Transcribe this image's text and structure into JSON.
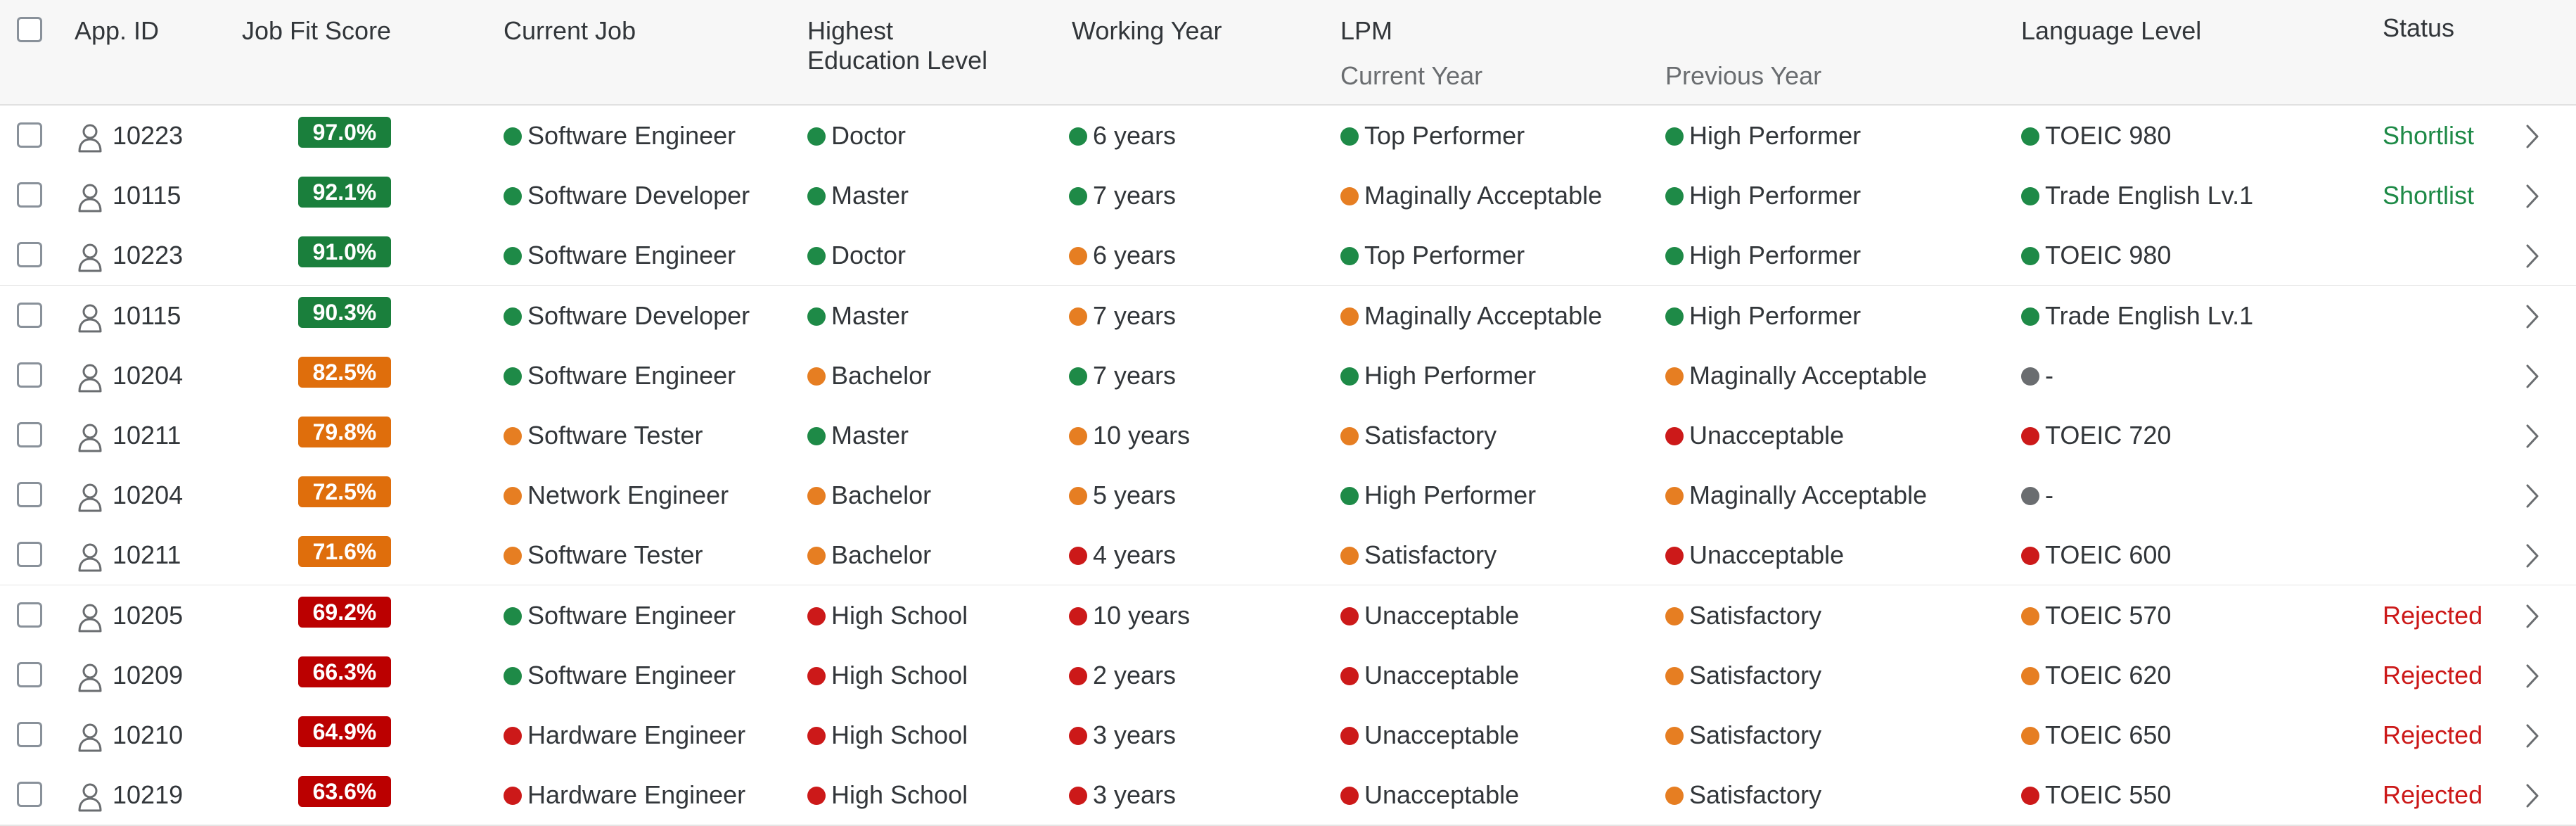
{
  "colors": {
    "green": "#1e8a47",
    "orange": "#e67e22",
    "red": "#cc1919",
    "grey": "#6a6d70",
    "badge_green": "#1a7f3c",
    "badge_orange": "#df6e0c",
    "badge_red": "#bb0000"
  },
  "header": {
    "app_id": "App. ID",
    "job_fit_score": "Job Fit Score",
    "current_job": "Current Job",
    "education_line1": "Highest",
    "education_line2": "Education Level",
    "working_year": "Working Year",
    "lpm": "LPM",
    "lpm_current": "Current Year",
    "lpm_previous": "Previous Year",
    "language_level": "Language Level",
    "status": "Status"
  },
  "rows": [
    {
      "id": "10223",
      "score": "97.0%",
      "score_color": "green",
      "job": "Software Engineer",
      "job_color": "green",
      "edu": "Doctor",
      "edu_color": "green",
      "year": "6 years",
      "year_color": "green",
      "lpm_cur": "Top Performer",
      "lpm_cur_color": "green",
      "lpm_prev": "High Performer",
      "lpm_prev_color": "green",
      "lang": "TOEIC 980",
      "lang_color": "green",
      "status": "Shortlist",
      "status_color": "green"
    },
    {
      "id": "10115",
      "score": "92.1%",
      "score_color": "green",
      "job": "Software Developer",
      "job_color": "green",
      "edu": "Master",
      "edu_color": "green",
      "year": "7 years",
      "year_color": "green",
      "lpm_cur": "Maginally Acceptable",
      "lpm_cur_color": "orange",
      "lpm_prev": "High Performer",
      "lpm_prev_color": "green",
      "lang": "Trade English Lv.1",
      "lang_color": "green",
      "status": "Shortlist",
      "status_color": "green"
    },
    {
      "id": "10223",
      "score": "91.0%",
      "score_color": "green",
      "job": "Software Engineer",
      "job_color": "green",
      "edu": "Doctor",
      "edu_color": "green",
      "year": "6 years",
      "year_color": "orange",
      "lpm_cur": "Top Performer",
      "lpm_cur_color": "green",
      "lpm_prev": "High Performer",
      "lpm_prev_color": "green",
      "lang": "TOEIC 980",
      "lang_color": "green",
      "status": "",
      "status_color": "green"
    },
    {
      "id": "10115",
      "score": "90.3%",
      "score_color": "green",
      "job": "Software Developer",
      "job_color": "green",
      "edu": "Master",
      "edu_color": "green",
      "year": "7 years",
      "year_color": "orange",
      "lpm_cur": "Maginally Acceptable",
      "lpm_cur_color": "orange",
      "lpm_prev": "High Performer",
      "lpm_prev_color": "green",
      "lang": "Trade English Lv.1",
      "lang_color": "green",
      "status": "",
      "status_color": "green"
    },
    {
      "id": "10204",
      "score": "82.5%",
      "score_color": "orange",
      "job": "Software Engineer",
      "job_color": "green",
      "edu": "Bachelor",
      "edu_color": "orange",
      "year": "7 years",
      "year_color": "green",
      "lpm_cur": "High Performer",
      "lpm_cur_color": "green",
      "lpm_prev": "Maginally Acceptable",
      "lpm_prev_color": "orange",
      "lang": "-",
      "lang_color": "grey",
      "status": "",
      "status_color": "green"
    },
    {
      "id": "10211",
      "score": "79.8%",
      "score_color": "orange",
      "job": "Software Tester",
      "job_color": "orange",
      "edu": "Master",
      "edu_color": "green",
      "year": "10 years",
      "year_color": "orange",
      "lpm_cur": "Satisfactory",
      "lpm_cur_color": "orange",
      "lpm_prev": "Unacceptable",
      "lpm_prev_color": "red",
      "lang": "TOEIC 720",
      "lang_color": "red",
      "status": "",
      "status_color": "green"
    },
    {
      "id": "10204",
      "score": "72.5%",
      "score_color": "orange",
      "job": "Network Engineer",
      "job_color": "orange",
      "edu": "Bachelor",
      "edu_color": "orange",
      "year": "5 years",
      "year_color": "orange",
      "lpm_cur": "High Performer",
      "lpm_cur_color": "green",
      "lpm_prev": "Maginally Acceptable",
      "lpm_prev_color": "orange",
      "lang": "-",
      "lang_color": "grey",
      "status": "",
      "status_color": "green"
    },
    {
      "id": "10211",
      "score": "71.6%",
      "score_color": "orange",
      "job": "Software Tester",
      "job_color": "orange",
      "edu": "Bachelor",
      "edu_color": "orange",
      "year": "4 years",
      "year_color": "red",
      "lpm_cur": "Satisfactory",
      "lpm_cur_color": "orange",
      "lpm_prev": "Unacceptable",
      "lpm_prev_color": "red",
      "lang": "TOEIC 600",
      "lang_color": "red",
      "status": "",
      "status_color": "green"
    },
    {
      "id": "10205",
      "score": "69.2%",
      "score_color": "red",
      "job": "Software Engineer",
      "job_color": "green",
      "edu": "High School",
      "edu_color": "red",
      "year": "10 years",
      "year_color": "red",
      "lpm_cur": "Unacceptable",
      "lpm_cur_color": "red",
      "lpm_prev": "Satisfactory",
      "lpm_prev_color": "orange",
      "lang": "TOEIC 570",
      "lang_color": "orange",
      "status": "Rejected",
      "status_color": "red"
    },
    {
      "id": "10209",
      "score": "66.3%",
      "score_color": "red",
      "job": "Software Engineer",
      "job_color": "green",
      "edu": "High School",
      "edu_color": "red",
      "year": "2 years",
      "year_color": "red",
      "lpm_cur": "Unacceptable",
      "lpm_cur_color": "red",
      "lpm_prev": "Satisfactory",
      "lpm_prev_color": "orange",
      "lang": "TOEIC 620",
      "lang_color": "orange",
      "status": "Rejected",
      "status_color": "red"
    },
    {
      "id": "10210",
      "score": "64.9%",
      "score_color": "red",
      "job": "Hardware Engineer",
      "job_color": "red",
      "edu": "High School",
      "edu_color": "red",
      "year": "3 years",
      "year_color": "red",
      "lpm_cur": "Unacceptable",
      "lpm_cur_color": "red",
      "lpm_prev": "Satisfactory",
      "lpm_prev_color": "orange",
      "lang": "TOEIC 650",
      "lang_color": "orange",
      "status": "Rejected",
      "status_color": "red"
    },
    {
      "id": "10219",
      "score": "63.6%",
      "score_color": "red",
      "job": "Hardware Engineer",
      "job_color": "red",
      "edu": "High School",
      "edu_color": "red",
      "year": "3 years",
      "year_color": "red",
      "lpm_cur": "Unacceptable",
      "lpm_cur_color": "red",
      "lpm_prev": "Satisfactory",
      "lpm_prev_color": "orange",
      "lang": "TOEIC 550",
      "lang_color": "red",
      "status": "Rejected",
      "status_color": "red"
    }
  ]
}
